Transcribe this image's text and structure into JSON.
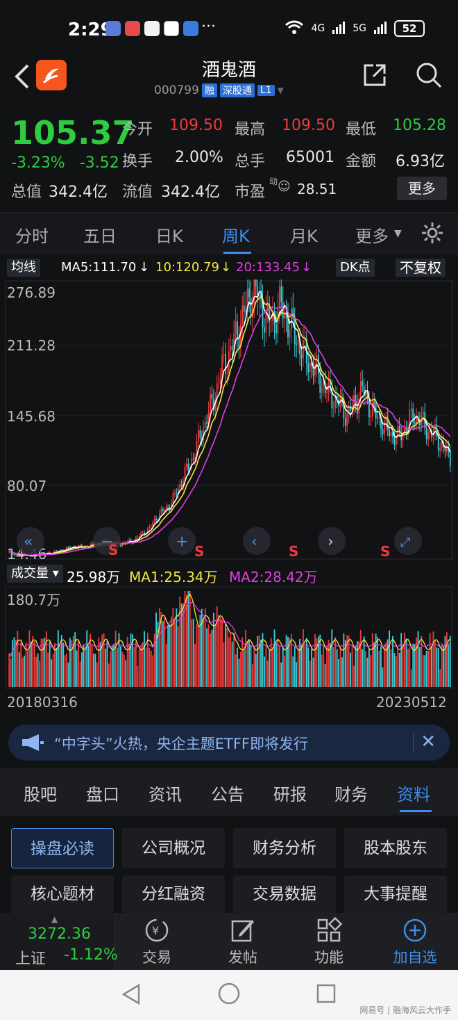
{
  "status": {
    "time": "2:29",
    "dots": "···",
    "net1": "4G",
    "net2": "5G",
    "battery": "52"
  },
  "header": {
    "back": "<",
    "name": "酒鬼酒",
    "code": "000799",
    "tag1": "融",
    "tag2": "深股通",
    "tag3": "L1"
  },
  "quote": {
    "price": "105.37",
    "pct": "-3.23%",
    "chg": "-3.52",
    "open_label": "今开",
    "open": "109.50",
    "high_label": "最高",
    "high": "109.50",
    "low_label": "最低",
    "low": "105.28",
    "turnover_label": "换手",
    "turnover": "2.00%",
    "vol_label": "总手",
    "vol": "65001",
    "amount_label": "金额",
    "amount": "6.93亿",
    "mcap_label": "总值",
    "mcap": "342.4亿",
    "float_label": "流值",
    "float": "342.4亿",
    "pe_label": "市盈",
    "pe_sup": "动",
    "pe": "28.51",
    "more": "更多"
  },
  "tabs": [
    "分时",
    "五日",
    "日K",
    "周K",
    "月K",
    "更多"
  ],
  "active_tab": "周K",
  "ma": {
    "label": "均线",
    "ma5": "MA5:111.70",
    "ma10": "10:120.79",
    "ma20": "20:133.45",
    "dk": "DK点",
    "adj": "不复权"
  },
  "axis": {
    "y1": "276.89",
    "y2": "211.28",
    "y3": "145.68",
    "y4": "80.07",
    "y5": "14.46",
    "vmax": "180.7万"
  },
  "signals": [
    "S",
    "S",
    "S",
    "S"
  ],
  "volume": {
    "label": "成交量",
    "v": "25.98万",
    "ma1": "MA1:25.34万",
    "ma2": "MA2:28.42万"
  },
  "dates": {
    "start": "20180316",
    "end": "20230512"
  },
  "banner": {
    "text": "“中字头”火热，央企主题ETFF即将发行"
  },
  "ftabs": [
    "股吧",
    "盘口",
    "资讯",
    "公告",
    "研报",
    "财务",
    "资料"
  ],
  "grid": [
    "操盘必读",
    "公司概况",
    "财务分析",
    "股本股东",
    "核心题材",
    "分红融资",
    "交易数据",
    "大事提醒"
  ],
  "index": {
    "value": "3272.36",
    "name": "上证",
    "pct": "-1.12%"
  },
  "bnav": [
    "交易",
    "发帖",
    "功能",
    "加自选"
  ],
  "watermark": "网易号 | 融海风云大作手",
  "colors": {
    "up": "#f03a3a",
    "down": "#2ecc40",
    "accent": "#3d8ef0",
    "ma5": "#ffffff",
    "ma10": "#f5e642",
    "ma20": "#e040e0"
  },
  "chart_data": {
    "type": "candlestick-weekly",
    "ylim": [
      14.46,
      276.89
    ],
    "ma_series": [
      "MA5",
      "MA10",
      "MA20"
    ],
    "closes": [
      18,
      16,
      15,
      15,
      16,
      17,
      18,
      20,
      22,
      24,
      23,
      25,
      27,
      28,
      27,
      26,
      28,
      30,
      36,
      40,
      52,
      58,
      65,
      80,
      95,
      110,
      130,
      150,
      170,
      196,
      210,
      230,
      250,
      270,
      262,
      240,
      245,
      255,
      240,
      225,
      210,
      200,
      190,
      175,
      168,
      160,
      150,
      162,
      175,
      160,
      148,
      140,
      132,
      128,
      140,
      150,
      145,
      135,
      130,
      120,
      108
    ]
  }
}
